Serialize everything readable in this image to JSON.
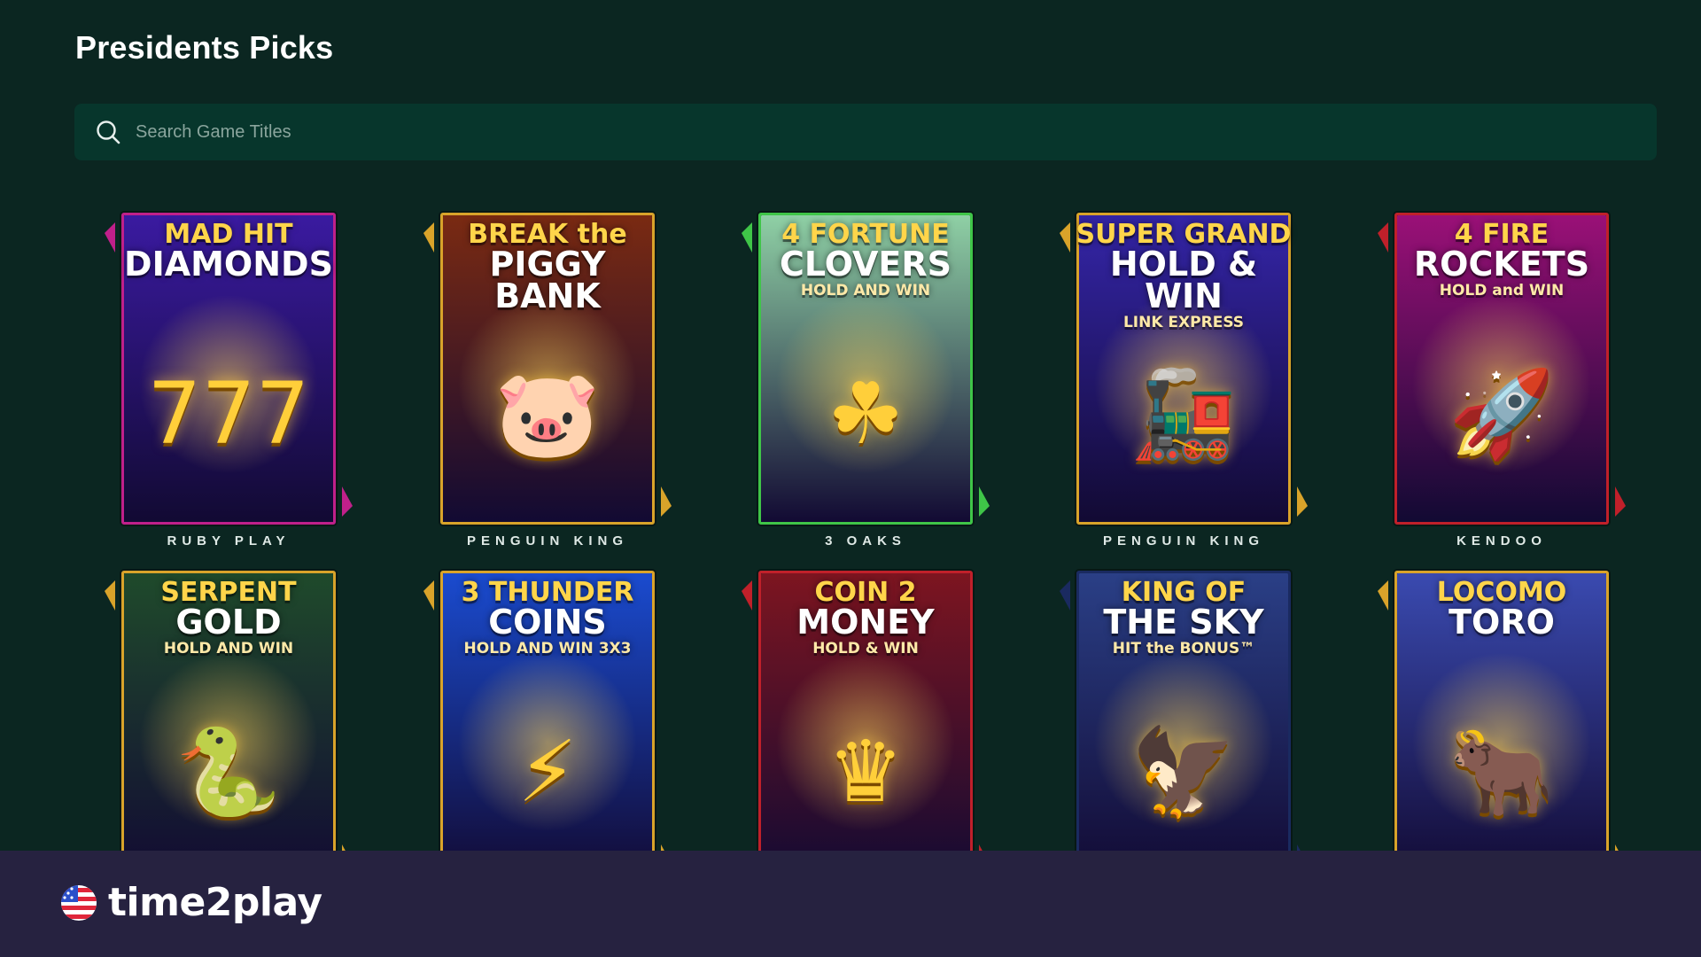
{
  "page": {
    "title": "Presidents Picks"
  },
  "search": {
    "placeholder": "Search Game Titles",
    "value": ""
  },
  "colors": {
    "background": "#0b2621",
    "search_bg": "#07362c",
    "footer_bg": "#262240"
  },
  "games": [
    {
      "art_line1": "MAD HIT",
      "art_line2": "DIAMONDS",
      "art_line3": "",
      "emblem": "777",
      "provider": "RUBY PLAY",
      "frame": "#c0208a",
      "bg": "#3a1aa0"
    },
    {
      "art_line1": "BREAK the",
      "art_line2": "PIGGY BANK",
      "art_line3": "",
      "emblem": "🐷",
      "provider": "PENGUIN KING",
      "frame": "#d9a32a",
      "bg": "#7a2a12"
    },
    {
      "art_line1": "4 FORTUNE",
      "art_line2": "CLOVERS",
      "art_line3": "HOLD AND WIN",
      "emblem": "☘",
      "provider": "3 OAKS",
      "frame": "#3fc548",
      "bg": "#8fd0a5"
    },
    {
      "art_line1": "SUPER GRAND",
      "art_line2": "HOLD & WIN",
      "art_line3": "LINK EXPRESS",
      "emblem": "🚂",
      "provider": "PENGUIN KING",
      "frame": "#d9a32a",
      "bg": "#3425a8"
    },
    {
      "art_line1": "4 FIRE",
      "art_line2": "ROCKETS",
      "art_line3": "HOLD and WIN",
      "emblem": "🚀",
      "provider": "KENDOO",
      "frame": "#c0202a",
      "bg": "#9a1077"
    },
    {
      "art_line1": "SERPENT",
      "art_line2": "GOLD",
      "art_line3": "HOLD AND WIN",
      "emblem": "🐍",
      "provider": "",
      "frame": "#d9a32a",
      "bg": "#1f4a2b"
    },
    {
      "art_line1": "3 THUNDER",
      "art_line2": "COINS",
      "art_line3": "HOLD AND WIN 3X3",
      "emblem": "⚡",
      "provider": "",
      "frame": "#d9a32a",
      "bg": "#1a4bcf"
    },
    {
      "art_line1": "COIN 2",
      "art_line2": "MONEY",
      "art_line3": "HOLD & WIN",
      "emblem": "♛",
      "provider": "",
      "frame": "#c0202a",
      "bg": "#7d1520"
    },
    {
      "art_line1": "KING OF",
      "art_line2": "THE SKY",
      "art_line3": "HIT the BONUS™",
      "emblem": "🦅",
      "provider": "",
      "frame": "#1a2a60",
      "bg": "#2a3f86"
    },
    {
      "art_line1": "LOCOMO",
      "art_line2": "TORO",
      "art_line3": "",
      "emblem": "🐂",
      "provider": "",
      "frame": "#d9a32a",
      "bg": "#3a4ab0"
    }
  ],
  "footer": {
    "brand": "time2play"
  }
}
